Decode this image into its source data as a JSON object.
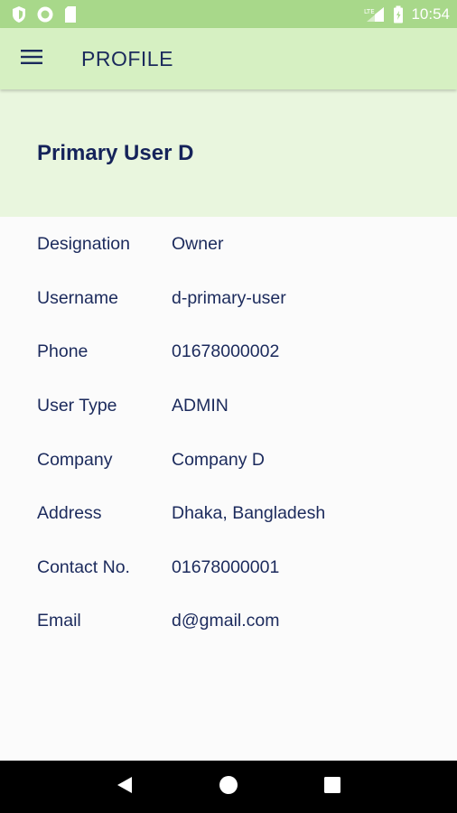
{
  "status_bar": {
    "time": "10:54",
    "icons_left": [
      "shield-icon",
      "circle-icon",
      "sd-card-icon"
    ],
    "icons_right": [
      "lte-signal-icon",
      "battery-icon"
    ]
  },
  "app_bar": {
    "title": "PROFILE",
    "menu_icon": "hamburger-menu-icon"
  },
  "profile": {
    "name": "Primary User D"
  },
  "details": [
    {
      "label": "Designation",
      "value": "Owner"
    },
    {
      "label": "Username",
      "value": "d-primary-user"
    },
    {
      "label": "Phone",
      "value": "01678000002"
    },
    {
      "label": "User Type",
      "value": "ADMIN"
    },
    {
      "label": "Company",
      "value": "Company D"
    },
    {
      "label": "Address",
      "value": "Dhaka, Bangladesh"
    },
    {
      "label": "Contact No.",
      "value": "01678000001"
    },
    {
      "label": "Email",
      "value": "d@gmail.com"
    }
  ],
  "nav_bar": {
    "icons": [
      "back-icon",
      "home-icon",
      "recents-icon"
    ]
  },
  "colors": {
    "status_bar": "#a8d88a",
    "app_bar": "#d6f0c2",
    "profile_header": "#e9f6de",
    "text": "#1b2a5c",
    "nav_bar": "#000000"
  }
}
